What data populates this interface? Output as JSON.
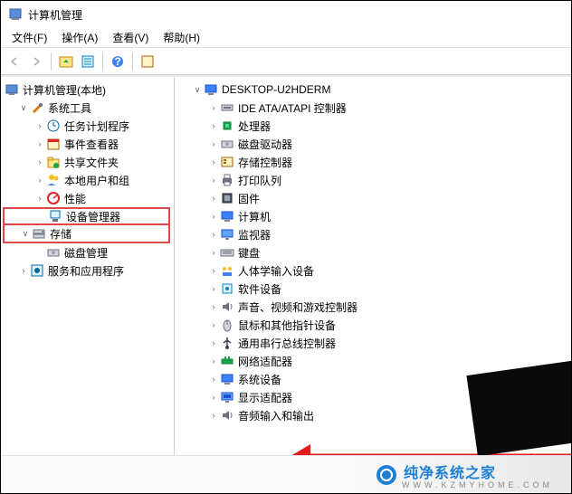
{
  "title": "计算机管理",
  "menu": {
    "file": "文件(F)",
    "action": "操作(A)",
    "view": "查看(V)",
    "help": "帮助(H)"
  },
  "left_tree": {
    "root": "计算机管理(本地)",
    "systools": "系统工具",
    "systools_children": [
      "任务计划程序",
      "事件查看器",
      "共享文件夹",
      "本地用户和组",
      "性能",
      "设备管理器"
    ],
    "storage": "存储",
    "storage_children": [
      "磁盘管理"
    ],
    "services": "服务和应用程序"
  },
  "right_tree": {
    "root": "DESKTOP-U2HDERM",
    "items": [
      "IDE ATA/ATAPI 控制器",
      "处理器",
      "磁盘驱动器",
      "存储控制器",
      "打印队列",
      "固件",
      "计算机",
      "监视器",
      "键盘",
      "人体学输入设备",
      "软件设备",
      "声音、视频和游戏控制器",
      "鼠标和其他指针设备",
      "通用串行总线控制器",
      "网络适配器",
      "系统设备",
      "显示适配器",
      "音频输入和输出"
    ]
  },
  "watermark": {
    "brand": "纯净系统之家",
    "url": "WWW.KZMYHOME.COM"
  }
}
